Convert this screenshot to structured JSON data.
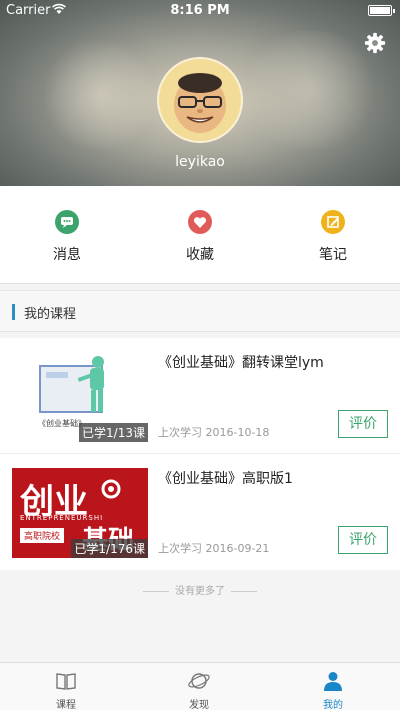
{
  "status_bar": {
    "carrier": "Carrier",
    "time": "8:16 PM"
  },
  "profile": {
    "username": "leyikao"
  },
  "quick_actions": [
    {
      "label": "消息",
      "icon": "message-icon",
      "color": "#3aa46c"
    },
    {
      "label": "收藏",
      "icon": "heart-icon",
      "color": "#e05a5a"
    },
    {
      "label": "笔记",
      "icon": "edit-icon",
      "color": "#f0b21a"
    }
  ],
  "section": {
    "title": "我的课程"
  },
  "courses": [
    {
      "title": "《创业基础》翻转课堂lym",
      "progress": "已学1/13课",
      "last_study": "上次学习 2016-10-18",
      "rate_label": "评价",
      "thumb_caption": "《创业基础》"
    },
    {
      "title": "《创业基础》高职版1",
      "progress": "已学1/176课",
      "last_study": "上次学习 2016-09-21",
      "rate_label": "评价",
      "thumb_main": "创业",
      "thumb_sub": "ENTREPRENEURSHI",
      "thumb_badge": "高职院校",
      "thumb_main2": "基础"
    }
  ],
  "footer": {
    "no_more": "没有更多了"
  },
  "tabbar": {
    "items": [
      {
        "label": "课程",
        "icon": "book-icon"
      },
      {
        "label": "发现",
        "icon": "planet-icon"
      },
      {
        "label": "我的",
        "icon": "person-icon",
        "active": true
      }
    ],
    "active_color": "#1a86c8"
  }
}
